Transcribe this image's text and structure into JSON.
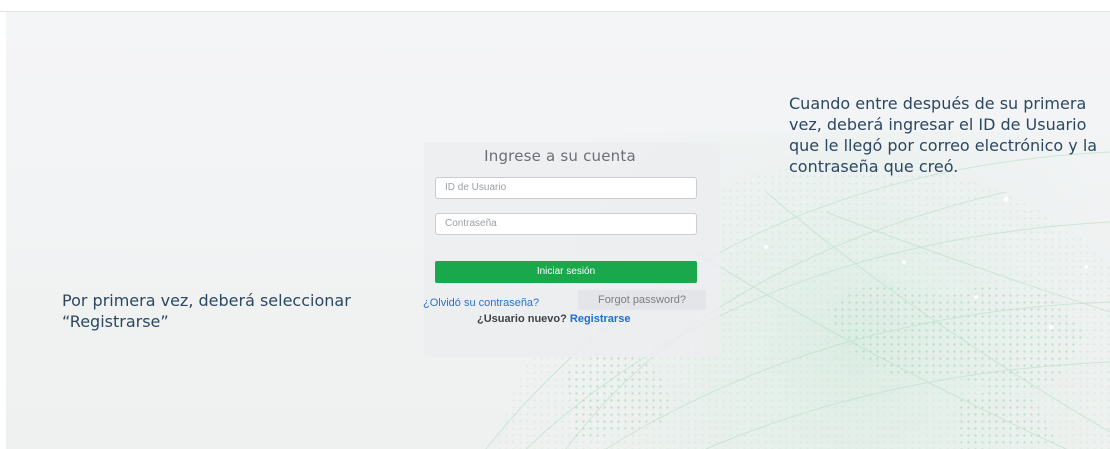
{
  "login": {
    "title": "Ingrese a su cuenta",
    "user_id_placeholder": "ID de Usuario",
    "password_placeholder": "Contraseña",
    "submit_label": "Iniciar sesión",
    "forgot_password_es": "¿Olvidó su contraseña?",
    "forgot_password_en": "Forgot password?",
    "new_user_question": "¿Usuario nuevo?",
    "register_label": "Registrarse"
  },
  "annotations": {
    "right": "Cuando entre después de su primera vez, deberá ingresar el ID de Usuario que le llegó por correo electrónico y la contraseña que creó.",
    "left": "Por primera vez, deberá seleccionar “Registrarse”"
  },
  "colors": {
    "primary_button": "#1aa84c",
    "link": "#1f6fd1",
    "caption_text": "#2c4761"
  }
}
